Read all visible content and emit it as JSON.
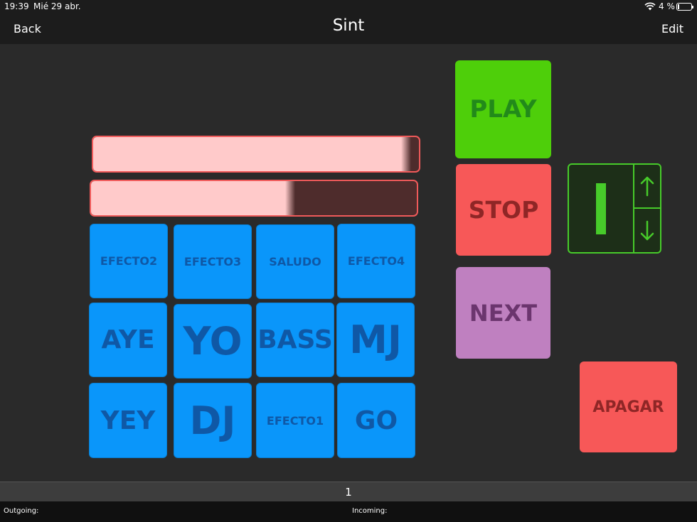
{
  "status": {
    "time": "19:39",
    "date": "Mié 29 abr.",
    "battery": "4 %",
    "battery_level": 0.04
  },
  "nav": {
    "back": "Back",
    "title": "Sint",
    "edit": "Edit"
  },
  "faders": [
    {
      "name": "fader-top",
      "level": 0.95
    },
    {
      "name": "fader-bottom",
      "level": 0.6
    }
  ],
  "pads": [
    {
      "label": "EFECTO2",
      "size": "small"
    },
    {
      "label": "EFECTO3",
      "size": "small"
    },
    {
      "label": "SALUDO",
      "size": "small"
    },
    {
      "label": "EFECTO4",
      "size": "small"
    },
    {
      "label": "AYE",
      "size": "large"
    },
    {
      "label": "YO",
      "size": "xlarge"
    },
    {
      "label": "BASS",
      "size": "large"
    },
    {
      "label": "MJ",
      "size": "xlarge"
    },
    {
      "label": "YEY",
      "size": "large"
    },
    {
      "label": "DJ",
      "size": "xlarge"
    },
    {
      "label": "EFECTO1",
      "size": "small"
    },
    {
      "label": "GO",
      "size": "large"
    }
  ],
  "buttons": {
    "play": "PLAY",
    "stop": "STOP",
    "next": "NEXT",
    "apagar": "APAGAR"
  },
  "stepper": {
    "value": 1,
    "up_icon": "arrow-up-icon",
    "down_icon": "arrow-down-icon"
  },
  "page": {
    "number": "1"
  },
  "footer": {
    "outgoing": "Outgoing:",
    "incoming": "Incoming:"
  },
  "colors": {
    "pad": "#0a96fa",
    "pad_text": "#0f58a6",
    "play": "#4ecf0a",
    "stop": "#f75858",
    "next": "#bf80c0",
    "apagar": "#f75858",
    "fader_border": "#f05a5a",
    "fader_fill": "#ffcaca",
    "stepper": "#47cb2a"
  }
}
